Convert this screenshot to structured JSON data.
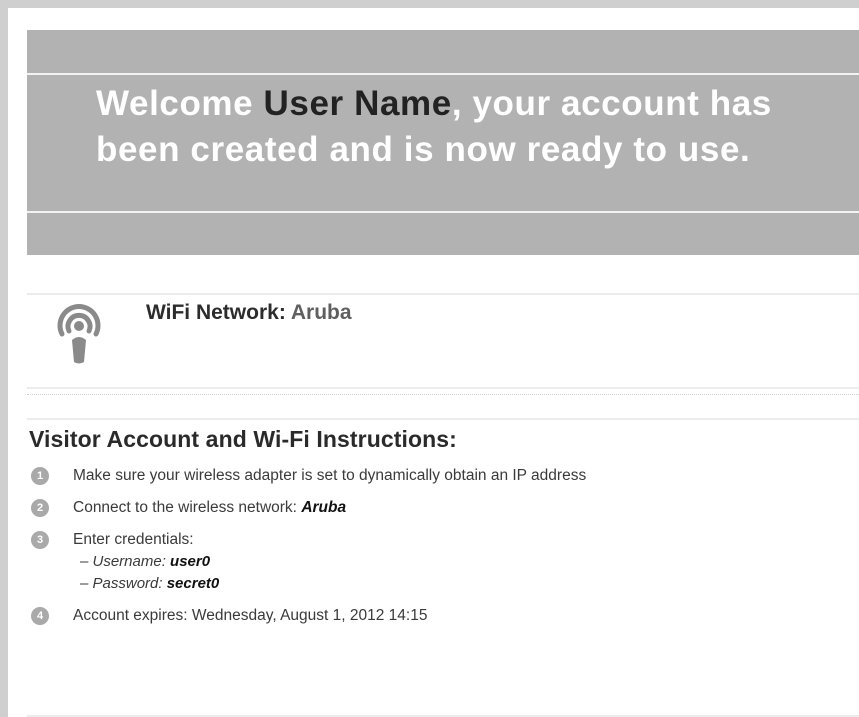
{
  "banner": {
    "welcome_prefix": "Welcome ",
    "user_name": "User Name",
    "welcome_suffix": ", your account has been created and is now ready to use."
  },
  "wifi": {
    "label": "WiFi Network: ",
    "network": "Aruba",
    "icon": "wifi-broadcast-icon"
  },
  "instructions": {
    "title": "Visitor Account and Wi-Fi Instructions:",
    "steps": [
      {
        "number": "1",
        "text": "Make sure your wireless adapter is set to dynamically obtain an IP address"
      },
      {
        "number": "2",
        "text": "Connect to the wireless network: ",
        "value": "Aruba"
      },
      {
        "number": "3",
        "text": "Enter credentials:",
        "username_label": "– Username: ",
        "username": "user0",
        "password_label": "– Password: ",
        "password": "secret0"
      },
      {
        "number": "4",
        "text": "Account expires: Wednesday, August 1, 2012 14:15"
      }
    ]
  },
  "colors": {
    "banner_bg": "#b2b2b2",
    "banner_text": "#ffffff",
    "user_name": "#222222",
    "step_badge": "#a9a9a9"
  }
}
